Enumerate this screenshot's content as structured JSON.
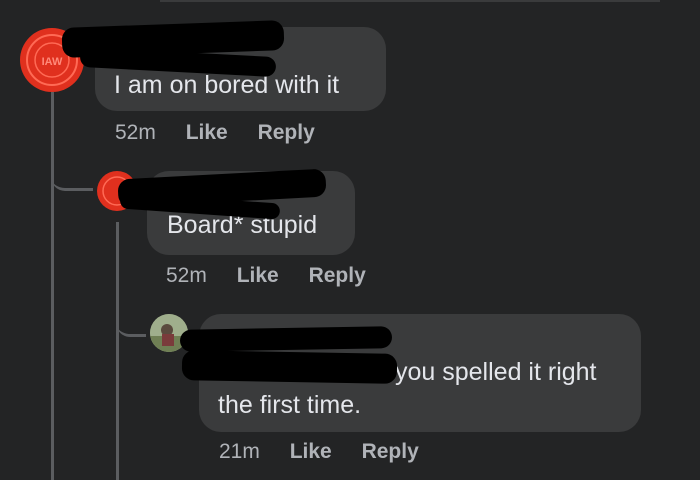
{
  "comments": [
    {
      "text": "I am on bored with it",
      "time": "52m",
      "like_label": "Like",
      "reply_label": "Reply",
      "avatar_color": "#e0301e",
      "avatar_logo_text": "IAW"
    },
    {
      "text": "Board* stupid",
      "time": "52m",
      "like_label": "Like",
      "reply_label": "Reply",
      "avatar_color": "#e0301e"
    },
    {
      "text_line1": "you spelled it right",
      "text_line2": "the first time.",
      "time": "21m",
      "like_label": "Like",
      "reply_label": "Reply"
    }
  ],
  "colors": {
    "background": "#232425",
    "bubble": "#3a3b3c",
    "text": "#e4e6eb",
    "meta": "#b0b3b8",
    "redaction": "#000000"
  }
}
